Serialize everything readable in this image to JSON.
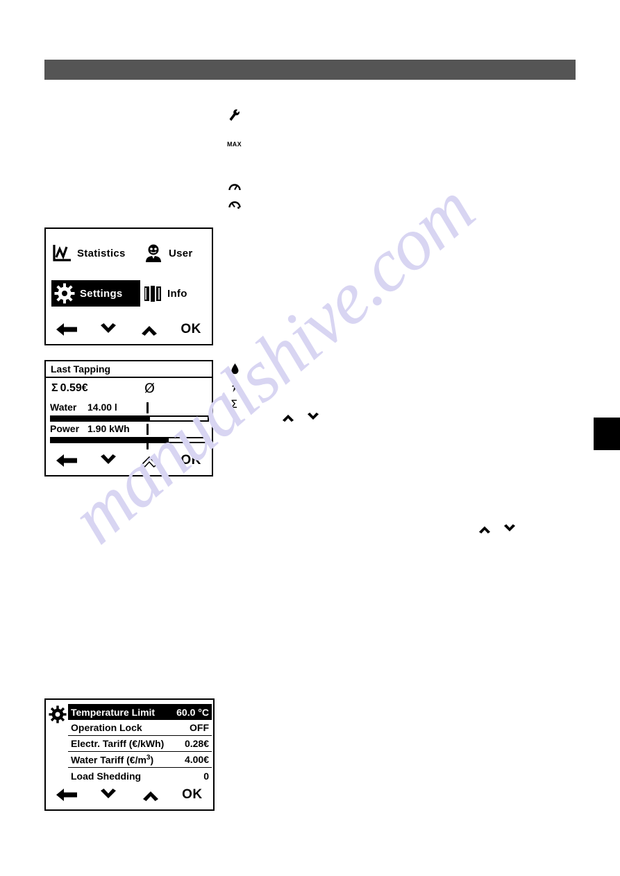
{
  "page": {
    "watermark": "manualshive.com",
    "header_bar_color": "#555555",
    "edge_tab_color": "#000000"
  },
  "main_menu_panel": {
    "items": [
      {
        "label": "Statistics",
        "icon": "statistics-chart-icon",
        "selected": false
      },
      {
        "label": "User",
        "icon": "user-face-icon",
        "selected": false
      },
      {
        "label": "Settings",
        "icon": "gear-icon",
        "selected": true
      },
      {
        "label": "Info",
        "icon": "info-book-icon",
        "selected": false
      }
    ],
    "nav": {
      "back": "back-arrow-icon",
      "down": "chevron-down-icon",
      "up": "chevron-up-icon",
      "ok_label": "OK"
    }
  },
  "last_tapping_panel": {
    "title": "Last Tapping",
    "sum_symbol": "Σ",
    "sum_value": "0.59€",
    "average_symbol": "Ø",
    "meters": [
      {
        "name": "Water",
        "value": "14.00 l",
        "fill_percent": 63
      },
      {
        "name": "Power",
        "value": "1.90 kWh",
        "fill_percent": 75
      }
    ],
    "nav": {
      "back": "back-arrow-icon",
      "down": "chevron-down-icon",
      "up": "chevron-up-outline-icon",
      "ok_label": "OK"
    }
  },
  "settings_panel": {
    "gear_icon": "gear-icon",
    "rows": [
      {
        "label": "Temperature Limit",
        "value": "60.0 °C",
        "selected": true
      },
      {
        "label": "Operation Lock",
        "value": "OFF",
        "selected": false
      },
      {
        "label": "Electr. Tariff (€/kWh)",
        "value": "0.28€",
        "selected": false
      },
      {
        "label": "Water Tariff (€/m",
        "label_sup": "3",
        "label_tail": ")",
        "value": "4.00€",
        "selected": false
      },
      {
        "label": "Load Shedding",
        "value": "0",
        "selected": false
      }
    ],
    "nav": {
      "back": "back-arrow-icon",
      "down": "chevron-down-icon",
      "up": "chevron-up-icon",
      "ok_label": "OK"
    }
  },
  "inline_icons": {
    "wrench": "wrench-icon",
    "max_label": "MAX",
    "gauge_full": "gauge-icon",
    "gauge_half": "gauge-half-icon",
    "water_drop": "water-drop-icon",
    "lightning": "lightning-bolt-icon",
    "sigma": "Σ"
  }
}
